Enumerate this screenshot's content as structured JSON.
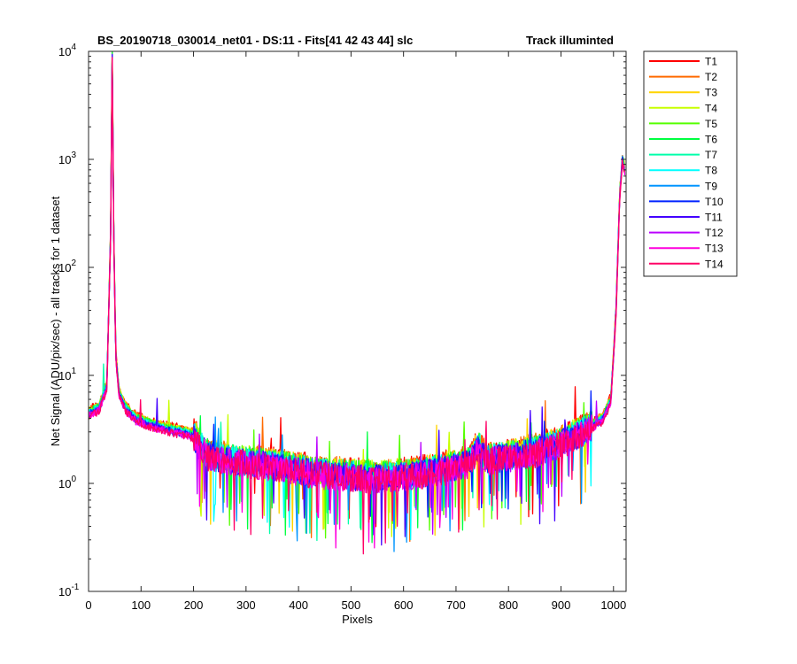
{
  "chart_data": {
    "type": "line",
    "title_left": "BS_20190718_030014_net01 - DS:11 - Fits[41   42   43   44]    slc",
    "title_right": "Track illuminted",
    "xlabel": "Pixels",
    "ylabel": "Net Signal (ADU/pix/sec) - all tracks for 1 dataset",
    "xlim": [
      0,
      1024
    ],
    "ylim": [
      0.1,
      10000
    ],
    "yscale": "log",
    "grid": false,
    "legend_position": "outside-right",
    "x_ticks": [
      "0",
      "100",
      "200",
      "300",
      "400",
      "500",
      "600",
      "700",
      "800",
      "900",
      "1000"
    ],
    "y_tick_mantissas": [
      "10",
      "10",
      "10",
      "10",
      "10",
      "10"
    ],
    "y_tick_exponents": [
      "-1",
      "0",
      "1",
      "2",
      "3",
      "4"
    ],
    "profile_x": [
      0,
      20,
      35,
      42,
      45,
      48,
      52,
      58,
      70,
      90,
      120,
      150,
      180,
      200,
      215,
      230,
      260,
      300,
      350,
      400,
      450,
      500,
      550,
      600,
      650,
      700,
      725,
      735,
      742,
      750,
      760,
      800,
      850,
      900,
      950,
      980,
      995,
      1005,
      1012,
      1017,
      1022
    ],
    "profile_y": [
      4.5,
      5,
      8,
      200,
      9000,
      200,
      15,
      7,
      5,
      4,
      3.5,
      3.2,
      3,
      2.8,
      2.2,
      1.8,
      1.7,
      1.6,
      1.5,
      1.35,
      1.25,
      1.2,
      1.15,
      1.2,
      1.3,
      1.45,
      1.6,
      1.9,
      2.3,
      1.9,
      1.7,
      1.8,
      2,
      2.4,
      3.2,
      4,
      6,
      40,
      500,
      1000,
      800
    ],
    "series": [
      {
        "name": "T1",
        "color": "#ff0000"
      },
      {
        "name": "T2",
        "color": "#ff6a00"
      },
      {
        "name": "T3",
        "color": "#ffd400"
      },
      {
        "name": "T4",
        "color": "#c8ff00"
      },
      {
        "name": "T5",
        "color": "#55ff00"
      },
      {
        "name": "T6",
        "color": "#00ff40"
      },
      {
        "name": "T7",
        "color": "#00ffaa"
      },
      {
        "name": "T8",
        "color": "#00ffff"
      },
      {
        "name": "T9",
        "color": "#0095ff"
      },
      {
        "name": "T10",
        "color": "#0022ff"
      },
      {
        "name": "T11",
        "color": "#4400ff"
      },
      {
        "name": "T12",
        "color": "#bb00ff"
      },
      {
        "name": "T13",
        "color": "#ff00dd"
      },
      {
        "name": "T14",
        "color": "#ff0066"
      }
    ]
  }
}
